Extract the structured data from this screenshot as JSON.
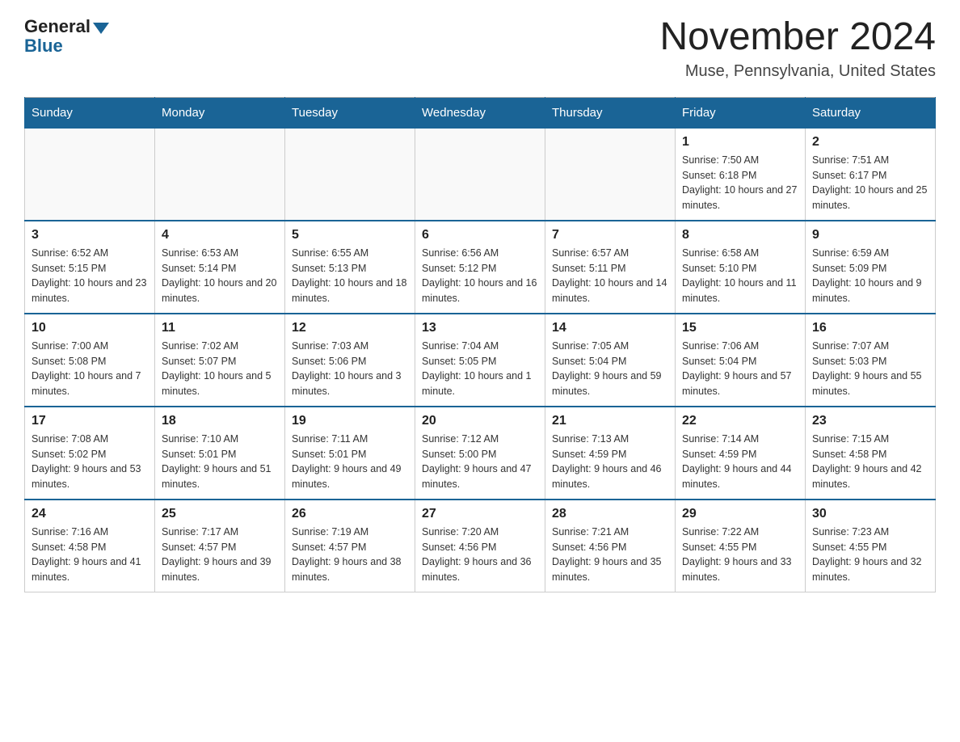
{
  "logo": {
    "general": "General",
    "blue": "Blue"
  },
  "title": "November 2024",
  "location": "Muse, Pennsylvania, United States",
  "days_of_week": [
    "Sunday",
    "Monday",
    "Tuesday",
    "Wednesday",
    "Thursday",
    "Friday",
    "Saturday"
  ],
  "weeks": [
    [
      {
        "day": "",
        "info": ""
      },
      {
        "day": "",
        "info": ""
      },
      {
        "day": "",
        "info": ""
      },
      {
        "day": "",
        "info": ""
      },
      {
        "day": "",
        "info": ""
      },
      {
        "day": "1",
        "info": "Sunrise: 7:50 AM\nSunset: 6:18 PM\nDaylight: 10 hours and 27 minutes."
      },
      {
        "day": "2",
        "info": "Sunrise: 7:51 AM\nSunset: 6:17 PM\nDaylight: 10 hours and 25 minutes."
      }
    ],
    [
      {
        "day": "3",
        "info": "Sunrise: 6:52 AM\nSunset: 5:15 PM\nDaylight: 10 hours and 23 minutes."
      },
      {
        "day": "4",
        "info": "Sunrise: 6:53 AM\nSunset: 5:14 PM\nDaylight: 10 hours and 20 minutes."
      },
      {
        "day": "5",
        "info": "Sunrise: 6:55 AM\nSunset: 5:13 PM\nDaylight: 10 hours and 18 minutes."
      },
      {
        "day": "6",
        "info": "Sunrise: 6:56 AM\nSunset: 5:12 PM\nDaylight: 10 hours and 16 minutes."
      },
      {
        "day": "7",
        "info": "Sunrise: 6:57 AM\nSunset: 5:11 PM\nDaylight: 10 hours and 14 minutes."
      },
      {
        "day": "8",
        "info": "Sunrise: 6:58 AM\nSunset: 5:10 PM\nDaylight: 10 hours and 11 minutes."
      },
      {
        "day": "9",
        "info": "Sunrise: 6:59 AM\nSunset: 5:09 PM\nDaylight: 10 hours and 9 minutes."
      }
    ],
    [
      {
        "day": "10",
        "info": "Sunrise: 7:00 AM\nSunset: 5:08 PM\nDaylight: 10 hours and 7 minutes."
      },
      {
        "day": "11",
        "info": "Sunrise: 7:02 AM\nSunset: 5:07 PM\nDaylight: 10 hours and 5 minutes."
      },
      {
        "day": "12",
        "info": "Sunrise: 7:03 AM\nSunset: 5:06 PM\nDaylight: 10 hours and 3 minutes."
      },
      {
        "day": "13",
        "info": "Sunrise: 7:04 AM\nSunset: 5:05 PM\nDaylight: 10 hours and 1 minute."
      },
      {
        "day": "14",
        "info": "Sunrise: 7:05 AM\nSunset: 5:04 PM\nDaylight: 9 hours and 59 minutes."
      },
      {
        "day": "15",
        "info": "Sunrise: 7:06 AM\nSunset: 5:04 PM\nDaylight: 9 hours and 57 minutes."
      },
      {
        "day": "16",
        "info": "Sunrise: 7:07 AM\nSunset: 5:03 PM\nDaylight: 9 hours and 55 minutes."
      }
    ],
    [
      {
        "day": "17",
        "info": "Sunrise: 7:08 AM\nSunset: 5:02 PM\nDaylight: 9 hours and 53 minutes."
      },
      {
        "day": "18",
        "info": "Sunrise: 7:10 AM\nSunset: 5:01 PM\nDaylight: 9 hours and 51 minutes."
      },
      {
        "day": "19",
        "info": "Sunrise: 7:11 AM\nSunset: 5:01 PM\nDaylight: 9 hours and 49 minutes."
      },
      {
        "day": "20",
        "info": "Sunrise: 7:12 AM\nSunset: 5:00 PM\nDaylight: 9 hours and 47 minutes."
      },
      {
        "day": "21",
        "info": "Sunrise: 7:13 AM\nSunset: 4:59 PM\nDaylight: 9 hours and 46 minutes."
      },
      {
        "day": "22",
        "info": "Sunrise: 7:14 AM\nSunset: 4:59 PM\nDaylight: 9 hours and 44 minutes."
      },
      {
        "day": "23",
        "info": "Sunrise: 7:15 AM\nSunset: 4:58 PM\nDaylight: 9 hours and 42 minutes."
      }
    ],
    [
      {
        "day": "24",
        "info": "Sunrise: 7:16 AM\nSunset: 4:58 PM\nDaylight: 9 hours and 41 minutes."
      },
      {
        "day": "25",
        "info": "Sunrise: 7:17 AM\nSunset: 4:57 PM\nDaylight: 9 hours and 39 minutes."
      },
      {
        "day": "26",
        "info": "Sunrise: 7:19 AM\nSunset: 4:57 PM\nDaylight: 9 hours and 38 minutes."
      },
      {
        "day": "27",
        "info": "Sunrise: 7:20 AM\nSunset: 4:56 PM\nDaylight: 9 hours and 36 minutes."
      },
      {
        "day": "28",
        "info": "Sunrise: 7:21 AM\nSunset: 4:56 PM\nDaylight: 9 hours and 35 minutes."
      },
      {
        "day": "29",
        "info": "Sunrise: 7:22 AM\nSunset: 4:55 PM\nDaylight: 9 hours and 33 minutes."
      },
      {
        "day": "30",
        "info": "Sunrise: 7:23 AM\nSunset: 4:55 PM\nDaylight: 9 hours and 32 minutes."
      }
    ]
  ]
}
